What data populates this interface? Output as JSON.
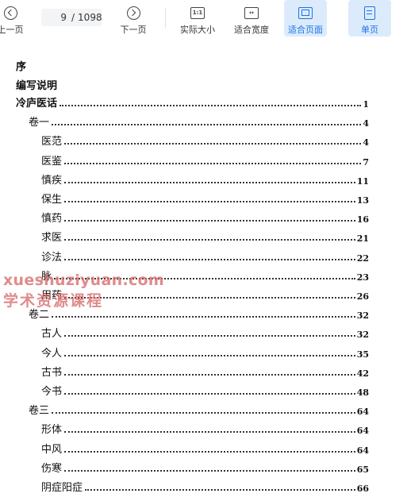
{
  "toolbar": {
    "prev_label": "上一页",
    "next_label": "下一页",
    "current_page": "9",
    "page_separator": "/",
    "total_pages": "1098",
    "actual_size_label": "实际大小",
    "actual_size_icon_text": "1:1",
    "fit_width_label": "适合宽度",
    "fit_page_label": "适合页面",
    "single_page_label": "单页",
    "accent_color": "#1a73e8"
  },
  "document": {
    "headings": [
      "序",
      "编写说明"
    ],
    "toc": [
      {
        "title": "冷庐医话",
        "page": "1",
        "level": 0
      },
      {
        "title": "卷一",
        "page": "4",
        "level": 1
      },
      {
        "title": "医范",
        "page": "4",
        "level": 2
      },
      {
        "title": "医鉴",
        "page": "7",
        "level": 2
      },
      {
        "title": "慎疾",
        "page": "11",
        "level": 2
      },
      {
        "title": "保生",
        "page": "13",
        "level": 2
      },
      {
        "title": "慎药",
        "page": "16",
        "level": 2
      },
      {
        "title": "求医",
        "page": "21",
        "level": 2
      },
      {
        "title": "诊法",
        "page": "22",
        "level": 2
      },
      {
        "title": "脉",
        "page": "23",
        "level": 2
      },
      {
        "title": "用药",
        "page": "26",
        "level": 2
      },
      {
        "title": "卷二",
        "page": "32",
        "level": 1
      },
      {
        "title": "古人",
        "page": "32",
        "level": 2
      },
      {
        "title": "今人",
        "page": "35",
        "level": 2
      },
      {
        "title": "古书",
        "page": "42",
        "level": 2
      },
      {
        "title": "今书",
        "page": "48",
        "level": 2
      },
      {
        "title": "卷三",
        "page": "64",
        "level": 1
      },
      {
        "title": "形体",
        "page": "64",
        "level": 2
      },
      {
        "title": "中风",
        "page": "64",
        "level": 2
      },
      {
        "title": "伤寒",
        "page": "65",
        "level": 2
      },
      {
        "title": "阴症阳症",
        "page": "66",
        "level": 2
      }
    ]
  },
  "watermark": {
    "line1": "xueshuziyuan.com",
    "line2": "学术资源课程"
  }
}
